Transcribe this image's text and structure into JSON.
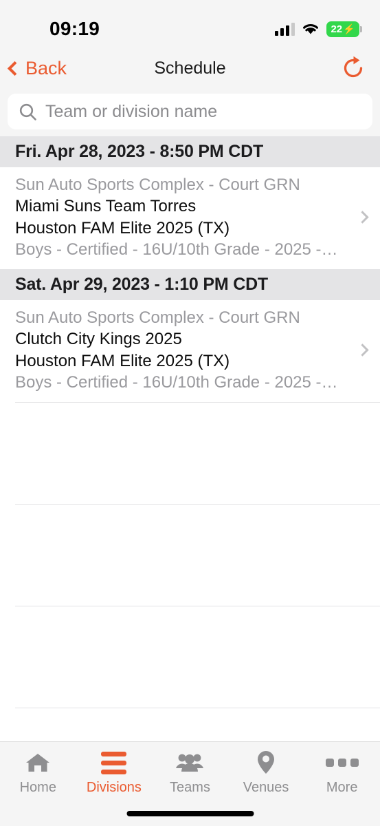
{
  "status_bar": {
    "time": "09:19",
    "battery_percent": "22",
    "battery_bolt": "⚡"
  },
  "nav": {
    "back_label": "Back",
    "title": "Schedule"
  },
  "search": {
    "placeholder": "Team or division name",
    "value": ""
  },
  "colors": {
    "accent": "#ea5b30",
    "battery_green": "#32d74b",
    "section_header_bg": "#e4e4e6",
    "muted_text": "#9a9a9e"
  },
  "sections": [
    {
      "header": "Fri. Apr 28, 2023 - 8:50 PM CDT",
      "games": [
        {
          "venue": "Sun Auto Sports Complex - Court GRN",
          "team_home": "Miami Suns Team Torres",
          "team_away": "Houston FAM Elite 2025 (TX)",
          "division": "Boys - Certified - 16U/10th Grade - 2025 -…"
        }
      ]
    },
    {
      "header": "Sat. Apr 29, 2023 - 1:10 PM CDT",
      "games": [
        {
          "venue": "Sun Auto Sports Complex - Court GRN",
          "team_home": "Clutch City Kings 2025",
          "team_away": "Houston FAM Elite 2025 (TX)",
          "division": "Boys - Certified - 16U/10th Grade - 2025 -…"
        }
      ]
    }
  ],
  "tabs": [
    {
      "label": "Home",
      "icon": "house-icon",
      "active": false
    },
    {
      "label": "Divisions",
      "icon": "divisions-icon",
      "active": true
    },
    {
      "label": "Teams",
      "icon": "people-icon",
      "active": false
    },
    {
      "label": "Venues",
      "icon": "map-pin-icon",
      "active": false
    },
    {
      "label": "More",
      "icon": "ellipsis-icon",
      "active": false
    }
  ]
}
